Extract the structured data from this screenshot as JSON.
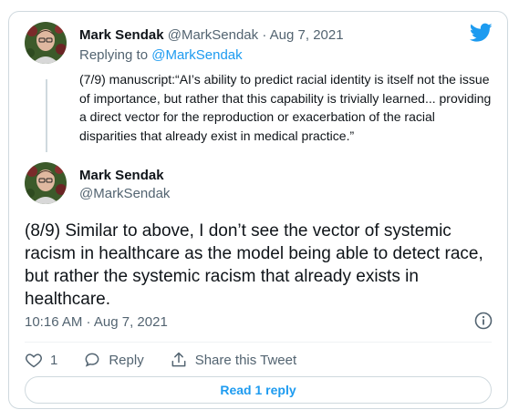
{
  "quoted": {
    "name": "Mark Sendak",
    "handle": "@MarkSendak",
    "separator": " · ",
    "date": "Aug 7, 2021",
    "replying_prefix": "Replying to ",
    "replying_to": "@MarkSendak",
    "text": "(7/9) manuscript:“AI’s ability to predict racial identity is itself not the issue of importance, but rather that this capability is trivially learned... providing a direct vector for the reproduction or exacerbation of the racial disparities that already exist in medical practice.”"
  },
  "main": {
    "name": "Mark Sendak",
    "handle": "@MarkSendak",
    "text": "(8/9) Similar to above, I don’t see the vector of systemic racism in healthcare as the model being able to detect race, but rather the systemic racism that already exists in healthcare.",
    "timestamp": "10:16 AM · Aug 7, 2021"
  },
  "actions": {
    "like_count": "1",
    "reply_label": "Reply",
    "share_label": "Share this Tweet"
  },
  "read_replies_label": "Read 1 reply",
  "icons": {
    "brand": "twitter-bird-icon",
    "info": "info-icon",
    "like": "heart-icon",
    "reply": "reply-bubble-icon",
    "share": "share-icon"
  },
  "colors": {
    "accent": "#1d9bf0",
    "secondary_text": "#536471",
    "border": "#cfd9de"
  }
}
